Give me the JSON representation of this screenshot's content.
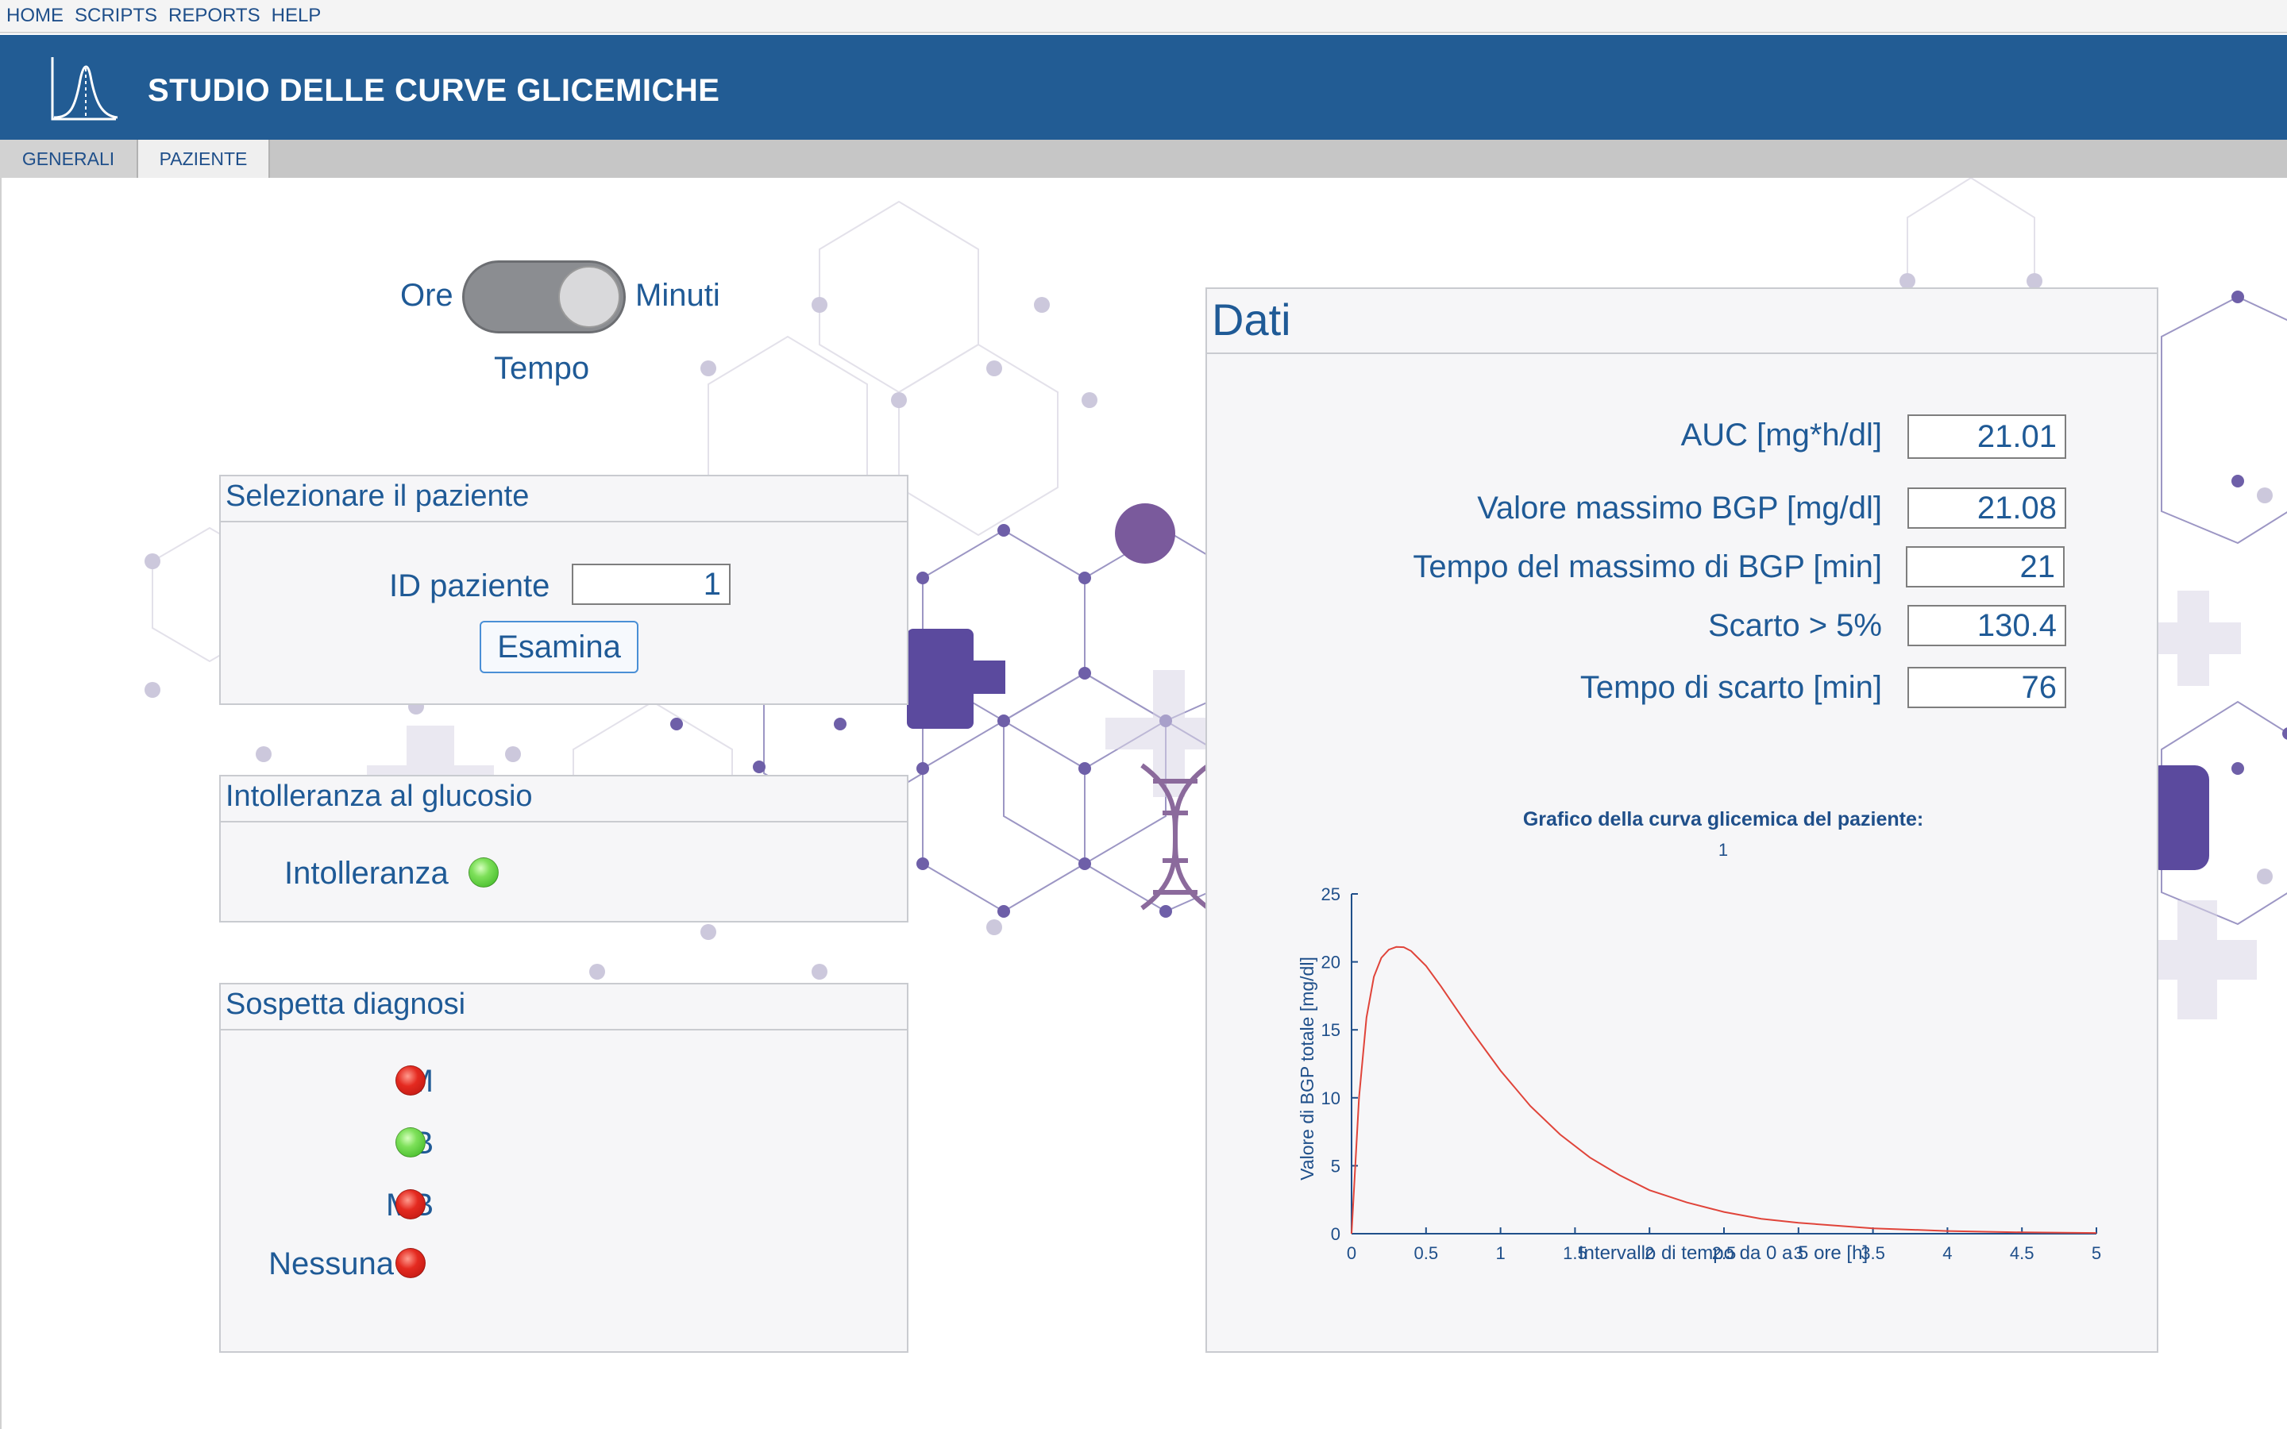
{
  "menubar": {
    "items": [
      "HOME",
      "SCRIPTS",
      "REPORTS",
      "HELP"
    ]
  },
  "header": {
    "title": "STUDIO DELLE CURVE GLICEMICHE",
    "logo_icon": "bell-curve-icon",
    "background": "#225c94"
  },
  "tabs": [
    {
      "label": "GENERALI",
      "selected": false
    },
    {
      "label": "PAZIENTE",
      "selected": true
    }
  ],
  "time_switch": {
    "left_label": "Ore",
    "right_label": "Minuti",
    "caption": "Tempo",
    "state": "Minuti"
  },
  "patient_panel": {
    "title": "Selezionare il paziente",
    "id_label": "ID paziente",
    "id_value": "1",
    "examine_label": "Esamina"
  },
  "intolerance_panel": {
    "title": "Intolleranza al glucosio",
    "label": "Intolleranza",
    "status": "green"
  },
  "diagnosis_panel": {
    "title": "Sospetta diagnosi",
    "items": [
      {
        "label": "M",
        "status": "red"
      },
      {
        "label": "B",
        "status": "green"
      },
      {
        "label": "MB",
        "status": "red"
      },
      {
        "label": "Nessuna",
        "status": "red"
      }
    ]
  },
  "data_panel": {
    "title": "Dati",
    "fields": [
      {
        "label": "AUC [mg*h/dl]",
        "value": "21.01"
      },
      {
        "label": "Valore massimo BGP [mg/dl]",
        "value": "21.08"
      },
      {
        "label": "Tempo del massimo di BGP [min]",
        "value": "21"
      },
      {
        "label": "Scarto > 5%",
        "value": "130.4"
      },
      {
        "label": "Tempo di scarto [min]",
        "value": "76"
      }
    ]
  },
  "chart_data": {
    "type": "line",
    "title": "Grafico della curva glicemica del paziente:",
    "subtitle": "1",
    "xlabel": "Intervallo di tempo da 0 a 5 ore [h]",
    "ylabel": "Valore di BGP totale [mg/dl]",
    "xlim": [
      0,
      5
    ],
    "ylim": [
      0,
      25
    ],
    "x_ticks": [
      "0",
      "0.5",
      "1",
      "1.5",
      "2",
      "2.5",
      "3",
      "3.5",
      "4",
      "4.5",
      "5"
    ],
    "y_ticks": [
      "0",
      "5",
      "10",
      "15",
      "20",
      "25"
    ],
    "line_color": "#e0443a",
    "series": [
      {
        "x": [
          0,
          0.05,
          0.1,
          0.15,
          0.2,
          0.25,
          0.3,
          0.35,
          0.4,
          0.5,
          0.6,
          0.7,
          0.8,
          0.9,
          1.0,
          1.2,
          1.4,
          1.6,
          1.8,
          2.0,
          2.25,
          2.5,
          2.75,
          3.0,
          3.5,
          4.0,
          4.5,
          5.0
        ],
        "y": [
          0,
          10.0,
          15.9,
          18.9,
          20.3,
          20.9,
          21.1,
          21.08,
          20.8,
          19.7,
          18.2,
          16.6,
          15.0,
          13.5,
          12.0,
          9.4,
          7.3,
          5.6,
          4.3,
          3.2,
          2.3,
          1.6,
          1.1,
          0.8,
          0.4,
          0.2,
          0.1,
          0.05
        ]
      }
    ]
  }
}
